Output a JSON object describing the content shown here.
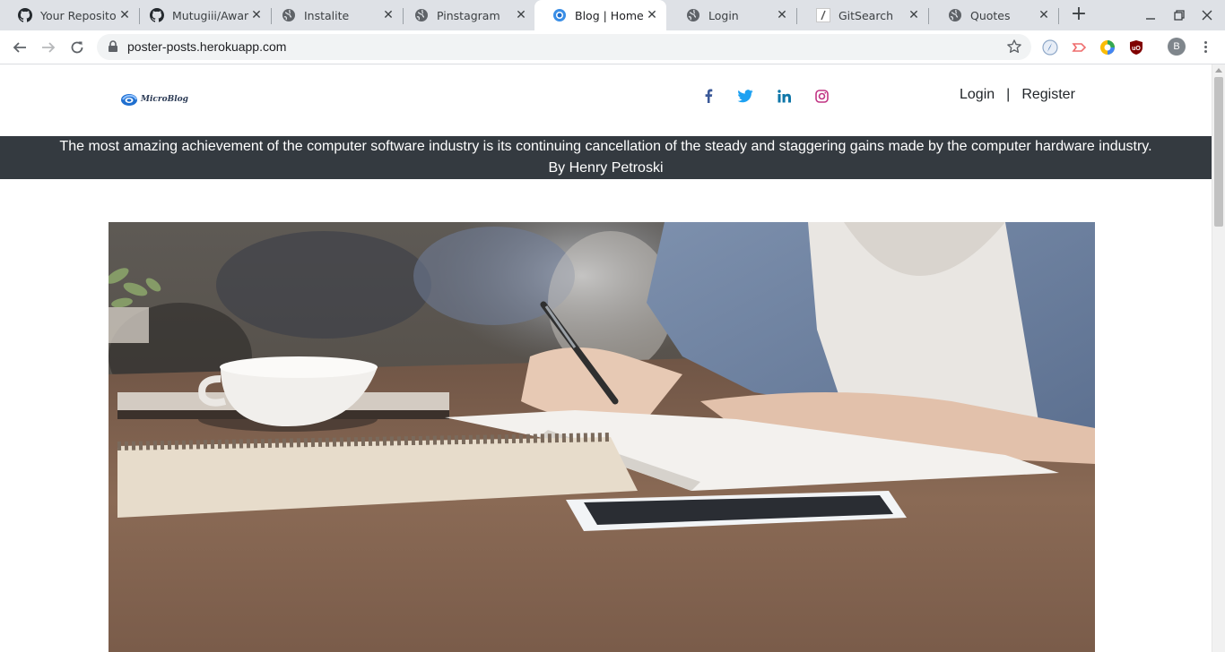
{
  "browser": {
    "tabs": [
      {
        "title": "Your Reposito",
        "favicon": "github-icon"
      },
      {
        "title": "Mutugiii/Awar",
        "favicon": "github-icon"
      },
      {
        "title": "Instalite",
        "favicon": "globe-icon"
      },
      {
        "title": "Pinstagram",
        "favicon": "globe-icon"
      },
      {
        "title": "Blog | Home",
        "favicon": "microblog-icon",
        "active": true
      },
      {
        "title": "Login",
        "favicon": "globe-icon"
      },
      {
        "title": "GitSearch",
        "favicon": "slash-icon"
      },
      {
        "title": "Quotes",
        "favicon": "globe-icon"
      }
    ],
    "url": "poster-posts.herokuapp.com",
    "profile_initial": "B"
  },
  "site": {
    "logo_text": "MicroBlog",
    "nav": {
      "login": "Login",
      "separator": "|",
      "register": "Register"
    },
    "social": [
      "facebook-icon",
      "twitter-icon",
      "linkedin-icon",
      "instagram-icon"
    ],
    "quote": {
      "text": "The most amazing achievement of the computer software industry is its continuing cancellation of the steady and staggering gains made by the computer hardware industry.",
      "author": "By Henry Petroski"
    }
  },
  "colors": {
    "quote_bar": "#343a40",
    "facebook": "#3b5998",
    "twitter": "#1da1f2",
    "linkedin": "#0e76a8",
    "instagram": "#c13584"
  }
}
